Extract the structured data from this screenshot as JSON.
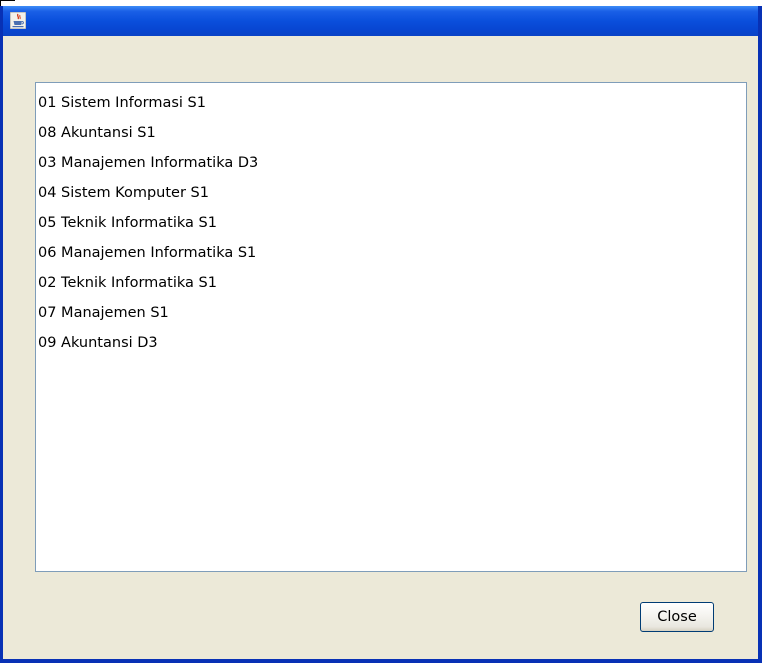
{
  "window": {
    "title": "",
    "icon": "java-coffee-cup-icon",
    "title_bar_color": "#0a4fdc",
    "client_bg_color": "#ece9d8"
  },
  "list": {
    "items": [
      {
        "label": "01 Sistem Informasi S1"
      },
      {
        "label": "08 Akuntansi S1"
      },
      {
        "label": "03 Manajemen Informatika D3"
      },
      {
        "label": "04 Sistem Komputer S1"
      },
      {
        "label": "05 Teknik Informatika S1"
      },
      {
        "label": "06 Manajemen Informatika S1"
      },
      {
        "label": "02 Teknik Informatika S1"
      },
      {
        "label": "07 Manajemen S1"
      },
      {
        "label": "09 Akuntansi D3"
      }
    ]
  },
  "buttons": {
    "close_label": "Close"
  }
}
